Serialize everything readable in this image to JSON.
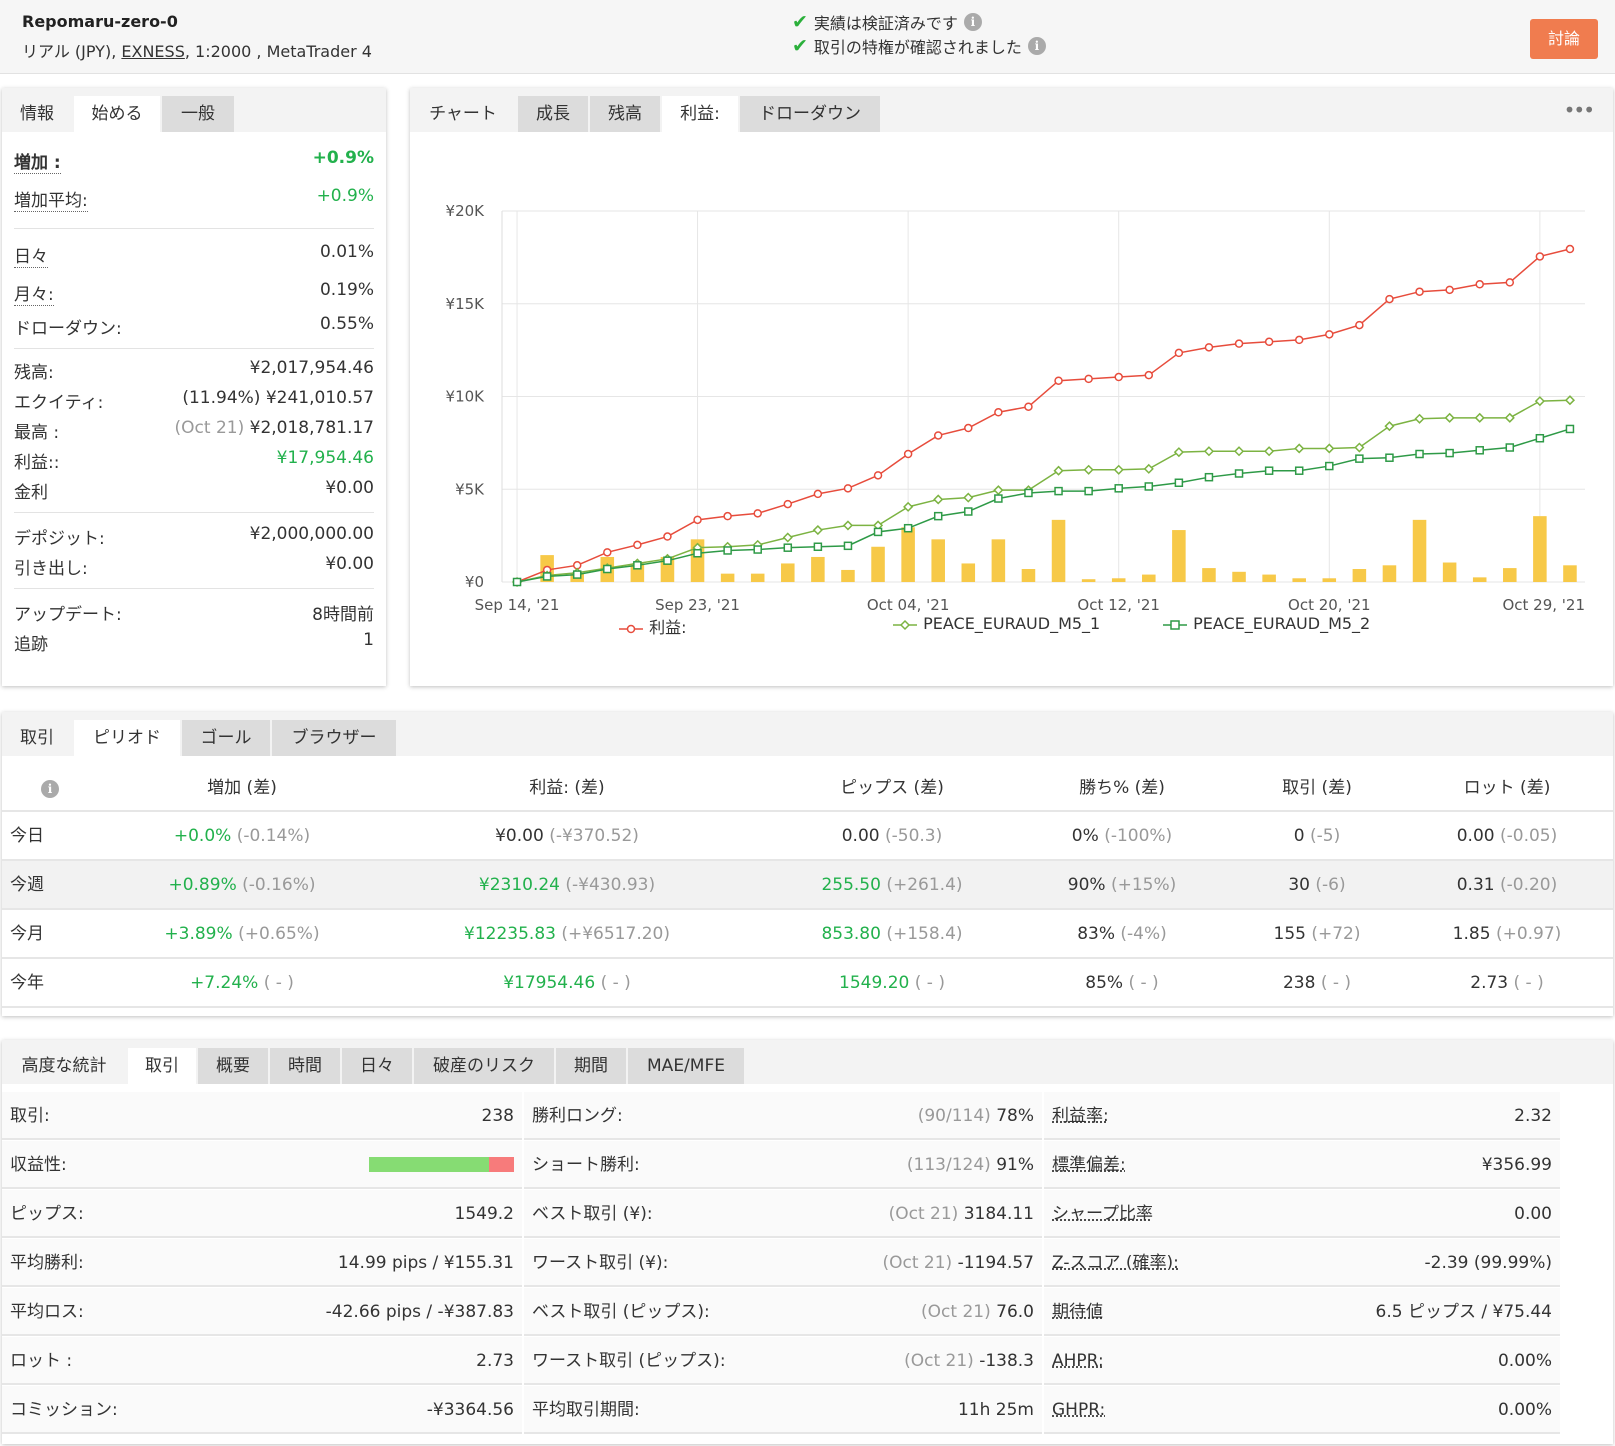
{
  "account": {
    "name": "Repomaru-zero-0",
    "type_prefix": "リアル (JPY),",
    "broker": "EXNESS",
    "type_suffix": ", 1:2000 , MetaTrader 4"
  },
  "verification": [
    {
      "text": "実績は検証済みです"
    },
    {
      "text": "取引の特権が確認されました"
    }
  ],
  "discuss_button": "討論",
  "info_panel": {
    "tabs": [
      "情報",
      "始める",
      "一般"
    ],
    "gain_label": "増加 :",
    "gain_value": "+0.9%",
    "avg_gain_label": "増加平均:",
    "avg_gain_value": "+0.9%",
    "daily_label": "日々",
    "daily_value": "0.01%",
    "monthly_label": "月々:",
    "monthly_value": "0.19%",
    "drawdown_label": "ドローダウン:",
    "drawdown_value": "0.55%",
    "balance_label": "残高:",
    "balance_value": "¥2,017,954.46",
    "equity_label": "エクイティ:",
    "equity_pct": "(11.94%)",
    "equity_value": "¥241,010.57",
    "highest_label": "最高 :",
    "highest_date": "(Oct 21)",
    "highest_value": "¥2,018,781.17",
    "profit_label": "利益::",
    "profit_value": "¥17,954.46",
    "interest_label": "金利",
    "interest_value": "¥0.00",
    "deposits_label": "デポジット:",
    "deposits_value": "¥2,000,000.00",
    "withdrawals_label": "引き出し:",
    "withdrawals_value": "¥0.00",
    "updated_label": "アップデート:",
    "updated_value": "8時間前",
    "tracking_label": "追跡",
    "tracking_value": "1"
  },
  "chart_panel": {
    "tabs": [
      "チャート",
      "成長",
      "残高",
      "利益:",
      "ドローダウン"
    ],
    "menu": "•••"
  },
  "chart_data": {
    "type": "line",
    "ylim": [
      0,
      20000
    ],
    "y_ticks": [
      "¥0",
      "¥5K",
      "¥10K",
      "¥15K",
      "¥20K"
    ],
    "x_tick_labels": [
      "Sep 14, '21",
      "Sep 23, '21",
      "Oct 04, '21",
      "Oct 12, '21",
      "Oct 20, '21",
      "Oct 29, '21"
    ],
    "x_tick_index": [
      0,
      6,
      13,
      20,
      27,
      34
    ],
    "points": 36,
    "series": [
      {
        "name": "利益:",
        "color": "#e74c3c",
        "marker": "circle",
        "values": [
          0,
          650,
          900,
          1600,
          2000,
          2450,
          3350,
          3550,
          3700,
          4200,
          4750,
          5050,
          5750,
          6900,
          7900,
          8300,
          9150,
          9450,
          10850,
          10950,
          11050,
          11150,
          12350,
          12650,
          12850,
          12950,
          13050,
          13350,
          13850,
          15250,
          15650,
          15750,
          16050,
          16150,
          17550,
          17950
        ]
      },
      {
        "name": "PEACE_EURAUD_M5_1",
        "color": "#7cb342",
        "marker": "diamond",
        "values": [
          0,
          350,
          500,
          750,
          1000,
          1250,
          1850,
          1900,
          2000,
          2400,
          2800,
          3050,
          3050,
          4050,
          4450,
          4550,
          4950,
          4950,
          6000,
          6050,
          6050,
          6100,
          7000,
          7050,
          7050,
          7050,
          7200,
          7200,
          7250,
          8400,
          8800,
          8850,
          8850,
          8850,
          9750,
          9800
        ]
      },
      {
        "name": "PEACE_EURAUD_M5_2",
        "color": "#2e9a47",
        "marker": "square",
        "values": [
          0,
          300,
          400,
          700,
          900,
          1150,
          1550,
          1700,
          1750,
          1850,
          1900,
          1950,
          2700,
          2900,
          3550,
          3800,
          4500,
          4800,
          4900,
          4900,
          5050,
          5150,
          5350,
          5650,
          5850,
          6000,
          6000,
          6250,
          6650,
          6700,
          6900,
          6950,
          7100,
          7250,
          7750,
          8250
        ]
      }
    ],
    "bars": {
      "color": "#f7c948",
      "values": [
        0,
        1450,
        450,
        1350,
        1000,
        1350,
        2300,
        450,
        450,
        1000,
        1350,
        650,
        1900,
        2950,
        2300,
        1000,
        2300,
        700,
        3350,
        150,
        200,
        400,
        2800,
        750,
        550,
        400,
        200,
        200,
        700,
        900,
        3350,
        1050,
        250,
        750,
        3550,
        900
      ]
    }
  },
  "period_panel": {
    "tabs": [
      "取引",
      "ピリオド",
      "ゴール",
      "ブラウザー"
    ],
    "headers": [
      "増加 (差)",
      "利益: (差)",
      "ピップス (差)",
      "勝ち% (差)",
      "取引 (差)",
      "ロット (差)"
    ],
    "rows": [
      {
        "label": "今日",
        "gain": "+0.0%",
        "gain_diff": "(-0.14%)",
        "profit": "¥0.00",
        "profit_diff": "(-¥370.52)",
        "pips": "0.00",
        "pips_diff": "(-50.3)",
        "win": "0%",
        "win_diff": "(-100%)",
        "trades": "0",
        "trades_diff": "(-5)",
        "lots": "0.00",
        "lots_diff": "(-0.05)"
      },
      {
        "label": "今週",
        "gain": "+0.89%",
        "gain_diff": "(-0.16%)",
        "profit": "¥2310.24",
        "profit_diff": "(-¥430.93)",
        "pips": "255.50",
        "pips_diff": "(+261.4)",
        "win": "90%",
        "win_diff": "(+15%)",
        "trades": "30",
        "trades_diff": "(-6)",
        "lots": "0.31",
        "lots_diff": "(-0.20)"
      },
      {
        "label": "今月",
        "gain": "+3.89%",
        "gain_diff": "(+0.65%)",
        "profit": "¥12235.83",
        "profit_diff": "(+¥6517.20)",
        "pips": "853.80",
        "pips_diff": "(+158.4)",
        "win": "83%",
        "win_diff": "(-4%)",
        "trades": "155",
        "trades_diff": "(+72)",
        "lots": "1.85",
        "lots_diff": "(+0.97)"
      },
      {
        "label": "今年",
        "gain": "+7.24%",
        "gain_diff": "( - )",
        "profit": "¥17954.46",
        "profit_diff": "( - )",
        "pips": "1549.20",
        "pips_diff": "( - )",
        "win": "85%",
        "win_diff": "( - )",
        "trades": "238",
        "trades_diff": "( - )",
        "lots": "2.73",
        "lots_diff": "( - )"
      }
    ]
  },
  "advanced_panel": {
    "tabs": [
      "高度な統計",
      "取引",
      "概要",
      "時間",
      "日々",
      "破産のリスク",
      "期間",
      "MAE/MFE"
    ],
    "profitability_ratio": 0.83,
    "col1": [
      {
        "label": "取引:",
        "value": "238"
      },
      {
        "label": "収益性:",
        "value": ""
      },
      {
        "label": "ピップス:",
        "value": "1549.2"
      },
      {
        "label": "平均勝利:",
        "value": "14.99 pips / ¥155.31"
      },
      {
        "label": "平均ロス:",
        "value": "-42.66 pips / -¥387.83"
      },
      {
        "label": "ロット :",
        "value": "2.73"
      },
      {
        "label": "コミッション:",
        "value": "-¥3364.56"
      }
    ],
    "col2": [
      {
        "label": "勝利ロング:",
        "muted": "(90/114)",
        "value": "78%"
      },
      {
        "label": "ショート勝利:",
        "muted": "(113/124)",
        "value": "91%"
      },
      {
        "label": "ベスト取引 (¥):",
        "muted": "(Oct 21)",
        "value": "3184.11"
      },
      {
        "label": "ワースト取引 (¥):",
        "muted": "(Oct 21)",
        "value": "-1194.57"
      },
      {
        "label": "ベスト取引 (ピップス):",
        "muted": "(Oct 21)",
        "value": "76.0"
      },
      {
        "label": "ワースト取引 (ピップス):",
        "muted": "(Oct 21)",
        "value": "-138.3"
      },
      {
        "label": "平均取引期間:",
        "muted": "",
        "value": "11h 25m"
      }
    ],
    "col3": [
      {
        "label": "利益率:",
        "value": "2.32"
      },
      {
        "label": "標準偏差:",
        "value": "¥356.99"
      },
      {
        "label": "シャープ比率",
        "value": "0.00"
      },
      {
        "label": "Z-スコア (確率):",
        "value": "-2.39 (99.99%)"
      },
      {
        "label": "期待値",
        "value": "6.5 ピップス / ¥75.44"
      },
      {
        "label": "AHPR:",
        "value": "0.00%"
      },
      {
        "label": "GHPR:",
        "value": "0.00%"
      }
    ]
  }
}
